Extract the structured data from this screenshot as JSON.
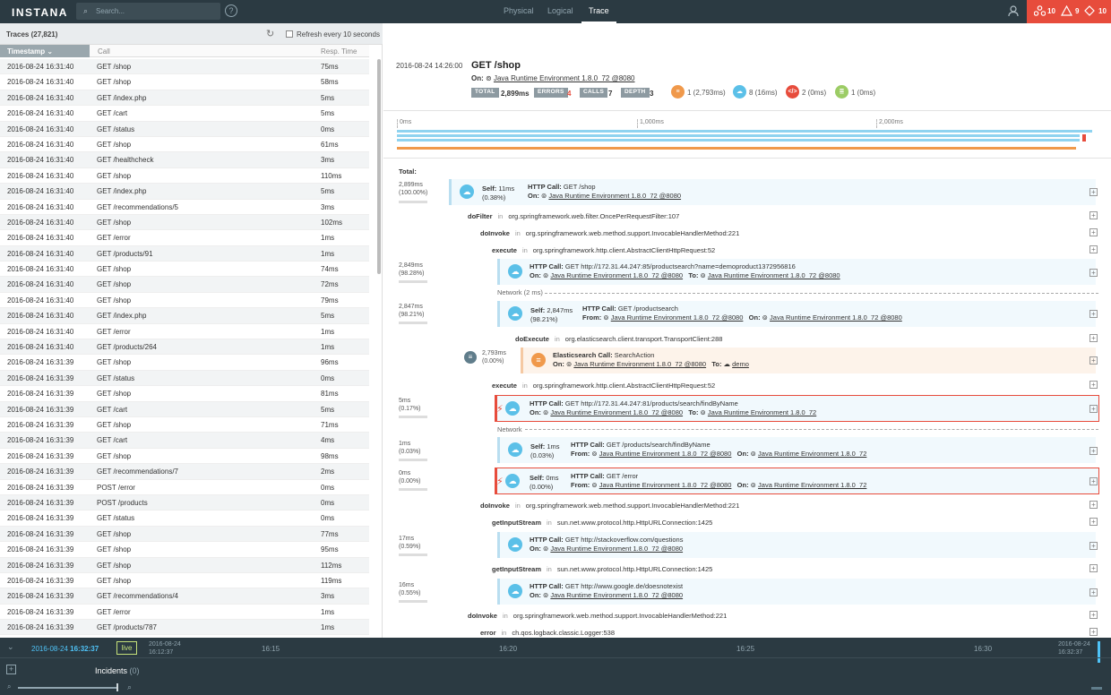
{
  "app": {
    "logo": "INSTANA",
    "search_placeholder": "Search...",
    "help": "?"
  },
  "nav": {
    "tabs": [
      "Physical",
      "Logical",
      "Trace"
    ],
    "active": "Trace"
  },
  "alerts": {
    "issues": "10",
    "warnings": "9",
    "incidents": "10"
  },
  "traces": {
    "title": "Traces (27,821)",
    "refresh_label": "Refresh every 10 seconds",
    "columns": {
      "timestamp": "Timestamp",
      "call": "Call",
      "resp": "Resp. Time"
    },
    "rows": [
      [
        "2016-08-24 16:31:40",
        "GET /shop",
        "75ms"
      ],
      [
        "2016-08-24 16:31:40",
        "GET /shop",
        "58ms"
      ],
      [
        "2016-08-24 16:31:40",
        "GET /index.php",
        "5ms"
      ],
      [
        "2016-08-24 16:31:40",
        "GET /cart",
        "5ms"
      ],
      [
        "2016-08-24 16:31:40",
        "GET /status",
        "0ms"
      ],
      [
        "2016-08-24 16:31:40",
        "GET /shop",
        "61ms"
      ],
      [
        "2016-08-24 16:31:40",
        "GET /healthcheck",
        "3ms"
      ],
      [
        "2016-08-24 16:31:40",
        "GET /shop",
        "110ms"
      ],
      [
        "2016-08-24 16:31:40",
        "GET /index.php",
        "5ms"
      ],
      [
        "2016-08-24 16:31:40",
        "GET /recommendations/5",
        "3ms"
      ],
      [
        "2016-08-24 16:31:40",
        "GET /shop",
        "102ms"
      ],
      [
        "2016-08-24 16:31:40",
        "GET /error",
        "1ms"
      ],
      [
        "2016-08-24 16:31:40",
        "GET /products/91",
        "1ms"
      ],
      [
        "2016-08-24 16:31:40",
        "GET /shop",
        "74ms"
      ],
      [
        "2016-08-24 16:31:40",
        "GET /shop",
        "72ms"
      ],
      [
        "2016-08-24 16:31:40",
        "GET /shop",
        "79ms"
      ],
      [
        "2016-08-24 16:31:40",
        "GET /index.php",
        "5ms"
      ],
      [
        "2016-08-24 16:31:40",
        "GET /error",
        "1ms"
      ],
      [
        "2016-08-24 16:31:40",
        "GET /products/264",
        "1ms"
      ],
      [
        "2016-08-24 16:31:39",
        "GET /shop",
        "96ms"
      ],
      [
        "2016-08-24 16:31:39",
        "GET /status",
        "0ms"
      ],
      [
        "2016-08-24 16:31:39",
        "GET /shop",
        "81ms"
      ],
      [
        "2016-08-24 16:31:39",
        "GET /cart",
        "5ms"
      ],
      [
        "2016-08-24 16:31:39",
        "GET /shop",
        "71ms"
      ],
      [
        "2016-08-24 16:31:39",
        "GET /cart",
        "4ms"
      ],
      [
        "2016-08-24 16:31:39",
        "GET /shop",
        "98ms"
      ],
      [
        "2016-08-24 16:31:39",
        "GET /recommendations/7",
        "2ms"
      ],
      [
        "2016-08-24 16:31:39",
        "POST /error",
        "0ms"
      ],
      [
        "2016-08-24 16:31:39",
        "POST /products",
        "0ms"
      ],
      [
        "2016-08-24 16:31:39",
        "GET /status",
        "0ms"
      ],
      [
        "2016-08-24 16:31:39",
        "GET /shop",
        "77ms"
      ],
      [
        "2016-08-24 16:31:39",
        "GET /shop",
        "95ms"
      ],
      [
        "2016-08-24 16:31:39",
        "GET /shop",
        "112ms"
      ],
      [
        "2016-08-24 16:31:39",
        "GET /shop",
        "119ms"
      ],
      [
        "2016-08-24 16:31:39",
        "GET /recommendations/4",
        "3ms"
      ],
      [
        "2016-08-24 16:31:39",
        "GET /error",
        "1ms"
      ],
      [
        "2016-08-24 16:31:39",
        "GET /products/787",
        "1ms"
      ]
    ]
  },
  "detail": {
    "date": "2016-08-24 14:26:00",
    "title": "GET /shop",
    "on_label": "On:",
    "on_value": "Java Runtime Environment 1.8.0_72 @8080",
    "badges": [
      {
        "label": "TOTAL",
        "value": "2,899ms"
      },
      {
        "label": "ERRORS",
        "value": "4"
      },
      {
        "label": "CALLS",
        "value": "7"
      },
      {
        "label": "DEPTH",
        "value": "3"
      }
    ],
    "counts": [
      {
        "icon": "database-icon",
        "color": "#f0994b",
        "text": "1 (2,793ms)"
      },
      {
        "icon": "cloud-icon",
        "color": "#5bc0e8",
        "text": "8 (16ms)"
      },
      {
        "icon": "code-icon",
        "color": "#e74c3c",
        "text": "2 (0ms)"
      },
      {
        "icon": "list-icon",
        "color": "#9ccc65",
        "text": "1 (0ms)"
      }
    ],
    "timeline_labels": [
      "0ms",
      "1,000ms",
      "2,000ms"
    ],
    "total_label": "Total:",
    "tree": {
      "p1a": "2,899ms",
      "p1b": "(100.00%)",
      "self1": "Self:",
      "self1v": "11ms",
      "self1p": "(0.38%)",
      "call1": "HTTP Call:",
      "call1v": "GET /shop",
      "on": "On:",
      "jre": "Java Runtime Environment 1.8.0_72 @8080",
      "jre2": "Java Runtime Environment 1.8.0_72",
      "in": "in",
      "doFilter": "doFilter",
      "doFilterLoc": "org.springframework.web.filter.OncePerRequestFilter:107",
      "doInvoke": "doInvoke",
      "doInvokeLoc": "org.springframework.web.method.support.InvocableHandlerMethod:221",
      "execute": "execute",
      "executeLoc": "org.springframework.http.client.AbstractClientHttpRequest:52",
      "p2a": "2,849ms",
      "p2b": "(98.28%)",
      "call2v": "GET http://172.31.44.247:85/productsearch?name=demoproduct1372956816",
      "to": "To:",
      "from": "From:",
      "net1": "Network (2 ms)",
      "p3a": "2,847ms",
      "p3b": "(98.21%)",
      "self3v": "2,847ms",
      "self3p": "(98.21%)",
      "call3v": "GET /productsearch",
      "doExecute": "doExecute",
      "doExecuteLoc": "org.elasticsearch.client.transport.TransportClient:288",
      "p4a": "2,793ms",
      "p4b": "(0.00%)",
      "es": "Elasticsearch Call:",
      "esv": "SearchAction",
      "demo": "demo",
      "p5a": "5ms",
      "p5b": "(0.17%)",
      "call5v": "GET http://172.31.44.247:81/products/search/findByName",
      "net2": "Network",
      "p6a": "1ms",
      "p6b": "(0.03%)",
      "self6v": "1ms",
      "self6p": "(0.03%)",
      "call6v": "GET /products/search/findByName",
      "p7a": "0ms",
      "p7b": "(0.00%)",
      "self7v": "0ms",
      "self7p": "(0.00%)",
      "call7v": "GET /error",
      "getInput": "getInputStream",
      "getInputLoc": "sun.net.www.protocol.http.HttpURLConnection:1425",
      "p8a": "17ms",
      "p8b": "(0.59%)",
      "call8v": "GET http://stackoverflow.com/questions",
      "p9a": "16ms",
      "p9b": "(0.55%)",
      "call9v": "GET http://www.google.de/doesnotexist",
      "error": "error",
      "errorLoc": "ch.qos.logback.classic.Logger:538"
    }
  },
  "bottom": {
    "chev": "⌄",
    "time_date": "2016-08-24",
    "time_clock": "16:32:37",
    "live": "live",
    "start_a": "2016-08-24",
    "start_b": "16:12:37",
    "ticks": [
      "16:15",
      "16:20",
      "16:25",
      "16:30"
    ],
    "end_a": "2016-08-24",
    "end_b": "16:32:37",
    "incidents": "Incidents",
    "incidents_count": "(0)"
  }
}
